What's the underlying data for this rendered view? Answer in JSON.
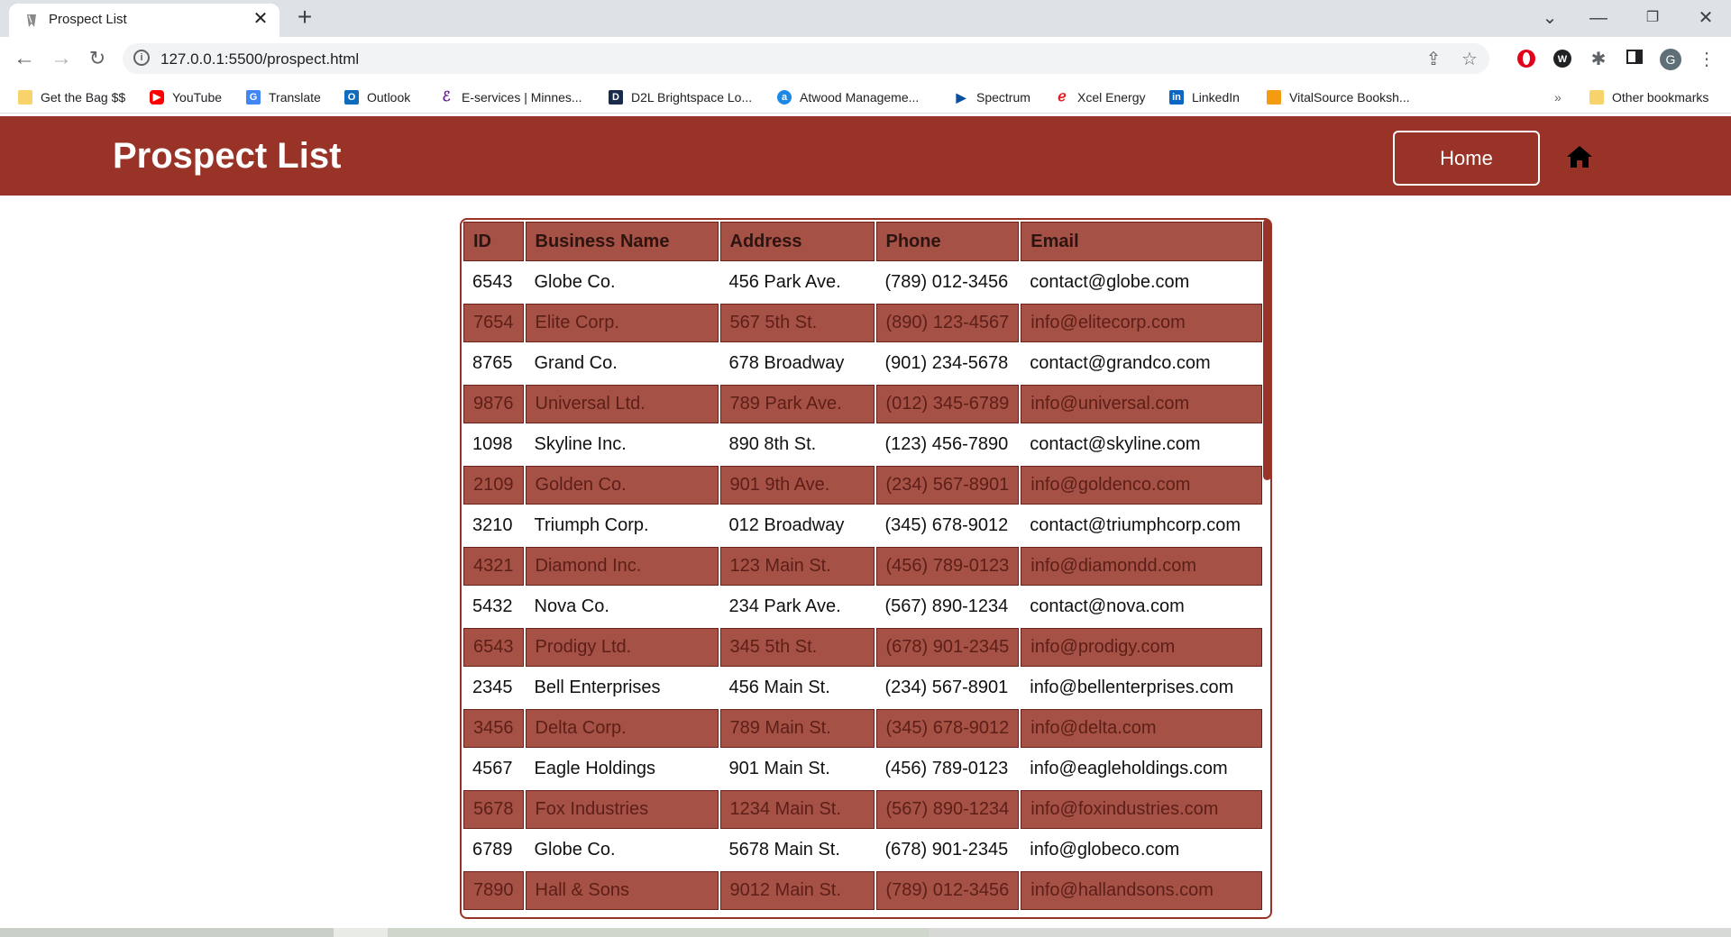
{
  "browser": {
    "tab_title": "Prospect List",
    "tab_close": "✕",
    "new_tab": "+",
    "url": "127.0.0.1:5500/prospect.html",
    "profile_initial": "G",
    "bookmarks": [
      {
        "label": "Get the Bag $$",
        "icon": "folder-icon",
        "color": "#f6d36b"
      },
      {
        "label": "YouTube",
        "icon": "youtube-icon",
        "color": "#ff0000"
      },
      {
        "label": "Translate",
        "icon": "translate-icon",
        "color": "#4285f4"
      },
      {
        "label": "Outlook",
        "icon": "outlook-icon",
        "color": "#0f6cbd"
      },
      {
        "label": "E-services | Minnes...",
        "icon": "eservices-icon",
        "color": "#6a1b9a"
      },
      {
        "label": "D2L Brightspace Lo...",
        "icon": "d2l-icon",
        "color": "#1a2a4a"
      },
      {
        "label": "Atwood Manageme...",
        "icon": "atwood-icon",
        "color": "#1e88e5"
      },
      {
        "label": "Spectrum",
        "icon": "spectrum-icon",
        "color": "#0a4ea0"
      },
      {
        "label": "Xcel Energy",
        "icon": "xcel-icon",
        "color": "#e21b23"
      },
      {
        "label": "LinkedIn",
        "icon": "linkedin-icon",
        "color": "#0a66c2"
      },
      {
        "label": "VitalSource Booksh...",
        "icon": "vitalsource-icon",
        "color": "#f39c12"
      }
    ],
    "bookmarks_overflow": "»",
    "other_bookmarks": "Other bookmarks"
  },
  "header": {
    "title": "Prospect List",
    "home_label": "Home"
  },
  "table": {
    "columns": [
      "ID",
      "Business Name",
      "Address",
      "Phone",
      "Email"
    ],
    "rows": [
      [
        "6543",
        "Globe Co.",
        "456 Park Ave.",
        "(789) 012-3456",
        "contact@globe.com"
      ],
      [
        "7654",
        "Elite Corp.",
        "567 5th St.",
        "(890) 123-4567",
        "info@elitecorp.com"
      ],
      [
        "8765",
        "Grand Co.",
        "678 Broadway",
        "(901) 234-5678",
        "contact@grandco.com"
      ],
      [
        "9876",
        "Universal Ltd.",
        "789 Park Ave.",
        "(012) 345-6789",
        "info@universal.com"
      ],
      [
        "1098",
        "Skyline Inc.",
        "890 8th St.",
        "(123) 456-7890",
        "contact@skyline.com"
      ],
      [
        "2109",
        "Golden Co.",
        "901 9th Ave.",
        "(234) 567-8901",
        "info@goldenco.com"
      ],
      [
        "3210",
        "Triumph Corp.",
        "012 Broadway",
        "(345) 678-9012",
        "contact@triumphcorp.com"
      ],
      [
        "4321",
        "Diamond Inc.",
        "123 Main St.",
        "(456) 789-0123",
        "info@diamondd.com"
      ],
      [
        "5432",
        "Nova Co.",
        "234 Park Ave.",
        "(567) 890-1234",
        "contact@nova.com"
      ],
      [
        "6543",
        "Prodigy Ltd.",
        "345 5th St.",
        "(678) 901-2345",
        "info@prodigy.com"
      ],
      [
        "2345",
        "Bell Enterprises",
        "456 Main St.",
        "(234) 567-8901",
        "info@bellenterprises.com"
      ],
      [
        "3456",
        "Delta Corp.",
        "789 Main St.",
        "(345) 678-9012",
        "info@delta.com"
      ],
      [
        "4567",
        "Eagle Holdings",
        "901 Main St.",
        "(456) 789-0123",
        "info@eagleholdings.com"
      ],
      [
        "5678",
        "Fox Industries",
        "1234 Main St.",
        "(567) 890-1234",
        "info@foxindustries.com"
      ],
      [
        "6789",
        "Globe Co.",
        "5678 Main St.",
        "(678) 901-2345",
        "info@globeco.com"
      ],
      [
        "7890",
        "Hall & Sons",
        "9012 Main St.",
        "(789) 012-3456",
        "info@hallandsons.com"
      ]
    ]
  },
  "colors": {
    "header_bg": "#993327",
    "row_alt_bg": "#a65145",
    "row_alt_text": "#5c1f18"
  }
}
